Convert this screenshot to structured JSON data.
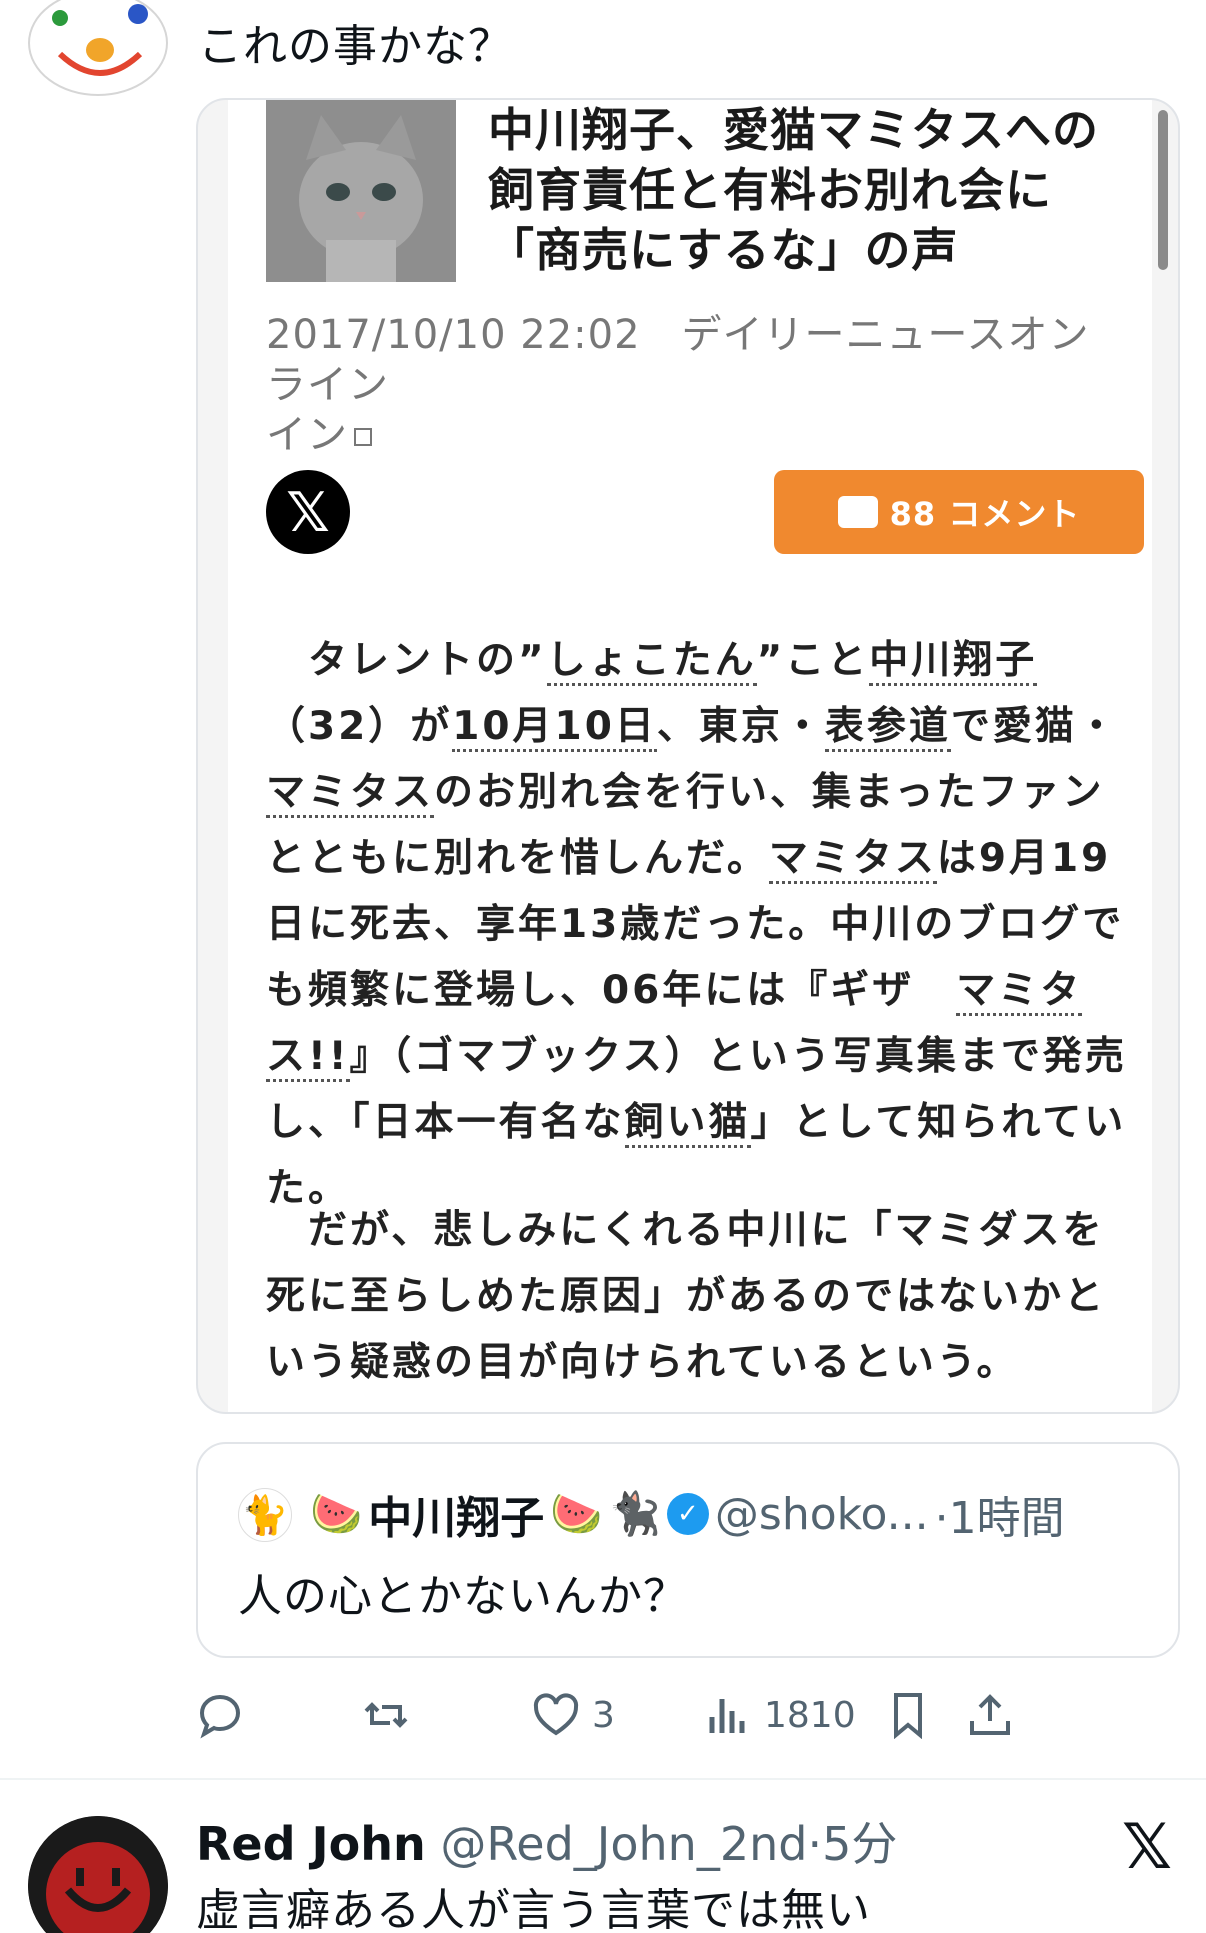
{
  "top_tweet": {
    "text": "これの事かな？"
  },
  "article": {
    "headline": "中川翔子、愛猫マミタスへの飼育責任と有料お別れ会に「商売にするな」の声",
    "meta": "2017/10/10 22:02　デイリーニュースオンライン",
    "comment_button_label": "88 コメント",
    "x_logo": "𝕏",
    "paragraph1": {
      "lead": "　タレントの”",
      "link1": "しょこたん",
      "mid1": "”こと",
      "link2": "中川翔子",
      "mid2": "（32）が",
      "link3": "10月10日",
      "mid3": "、東京・",
      "link4": "表参道",
      "mid4": "で愛猫・",
      "link5": "マミタス",
      "mid5": "のお別れ会を行い、集まったファンとともに別れを惜しんだ。",
      "link6": "マミタス",
      "mid6": "は9月19日に死去、享年13歳だった。中川のブログでも頻繁に登場し、06年には『ギザ　",
      "link7": "マミタス!!",
      "mid7": "』（ゴマブックス）という写真集まで発売し、「日本一有名な",
      "link8": "飼い猫",
      "tail": "」として知られていた。"
    },
    "paragraph2": "　だが、悲しみにくれる中川に「マミダスを死に至らしめた原因」があるのではないかという疑惑の目が向けられているという。"
  },
  "quoted_tweet": {
    "emoji_left": "🐈",
    "emoji_a": "🍉",
    "name": "中川翔子",
    "emoji_b": "🍉",
    "emoji_c": "🐈‍⬛",
    "verified_mark": "✓",
    "handle": "@shoko...",
    "time": "·1時間",
    "text": "人の心とかないんか？"
  },
  "actions": {
    "likes": "3",
    "views": "1810"
  },
  "next_tweet": {
    "name": "Red John",
    "handle": "@Red_John_2nd",
    "time": "·5分",
    "text": "虚言癖ある人が言う言葉では無い",
    "x_badge": "𝕏"
  },
  "colors": {
    "comment_button": "#f0892f",
    "verified": "#1d9bf0",
    "secondary_text": "#536471"
  }
}
